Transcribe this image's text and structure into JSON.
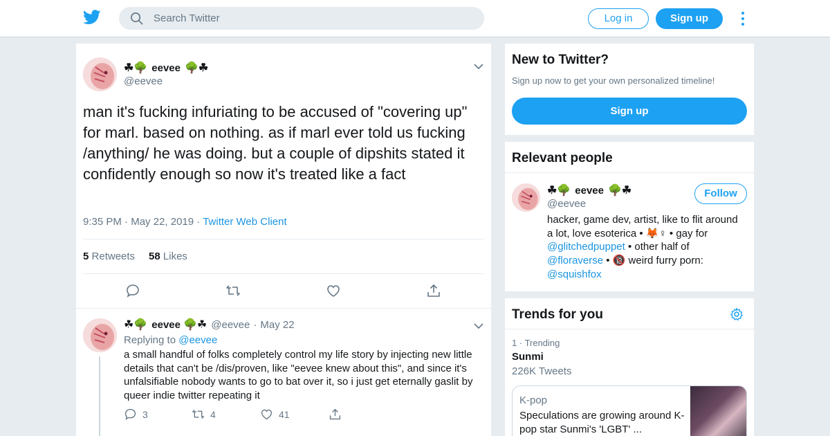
{
  "header": {
    "search_placeholder": "Search Twitter",
    "login_label": "Log in",
    "signup_label": "Sign up"
  },
  "tweet": {
    "name": "eevee",
    "emoji_left": "☘🌳",
    "emoji_right": "🌳☘",
    "handle": "@eevee",
    "text": "man it's fucking infuriating to be accused of \"covering up\" for marl.  based on nothing.  as if marl ever told us fucking /anything/ he was doing.  but a couple of dipshits stated it confidently enough so now it's treated like a fact",
    "time": "9:35 PM",
    "date": "May 22, 2019",
    "client": "Twitter Web Client",
    "retweet_count": "5",
    "retweet_label": "Retweets",
    "like_count": "58",
    "like_label": "Likes"
  },
  "reply": {
    "name": "eevee",
    "handle": "@eevee",
    "date": "May 22",
    "replying_label": "Replying to",
    "replying_to": "@eevee",
    "text": "a small handful of folks completely control my life story by injecting new little details that can't be /dis/proven, like \"eevee knew about this\", and since it's unfalsifiable nobody wants to go to bat over it, so i just get eternally gaslit by queer indie twitter repeating it",
    "reply_count": "3",
    "retweet_count": "4",
    "like_count": "41"
  },
  "new_to_twitter": {
    "title": "New to Twitter?",
    "subtitle": "Sign up now to get your own personalized timeline!",
    "button": "Sign up"
  },
  "relevant_people": {
    "title": "Relevant people",
    "name": "eevee",
    "handle": "@eevee",
    "follow_label": "Follow",
    "bio_1": "hacker, game dev, artist, like to flit around a lot, love esoterica • 🦊♀ • gay for",
    "bio_link_1": "@glitchedpuppet",
    "bio_2": " • other half of",
    "bio_link_2": "@floraverse",
    "bio_3": " • 🔞 weird furry porn:",
    "bio_link_3": "@squishfox"
  },
  "trends": {
    "title": "Trends for you",
    "rank": "1",
    "meta_label": "Trending",
    "name": "Sunmi",
    "count": "226K Tweets",
    "story_category": "K-pop",
    "story_headline": "Speculations are growing around K-pop star Sunmi's 'LGBT' ..."
  },
  "colors": {
    "accent": "#1da1f2",
    "link": "#1b95e0",
    "muted": "#657786",
    "background": "#e6ecf0"
  }
}
